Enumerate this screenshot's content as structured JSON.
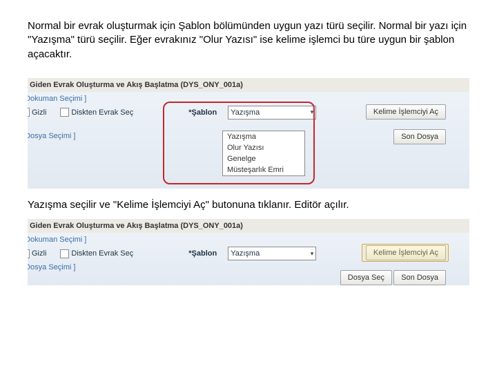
{
  "paragraphs": {
    "p1": "Normal bir evrak oluşturmak için Şablon bölümünden uygun yazı türü seçilir. Normal bir yazı için \"Yazışma\" türü seçilir. Eğer evrakınız \"Olur Yazısı\" ise kelime işlemci bu türe uygun bir şablon açacaktır.",
    "p2": "Yazışma seçilir ve \"Kelime İşlemciyi Aç\" butonuna tıklanır. Editör açılır."
  },
  "window": {
    "title": "Giden Evrak Oluşturma ve Akış Başlatma (DYS_ONY_001a)"
  },
  "sections": {
    "dokuman": "[ Dokuman Seçimi ]",
    "dosya": "[ Dosya Seçimi ]"
  },
  "checkboxes": {
    "gizli": "Gizli",
    "diskten": "Diskten Evrak Seç"
  },
  "sablon": {
    "label": "*Şablon",
    "selected": "Yazışma",
    "options": [
      "Yazışma",
      "Olur Yazısı",
      "Genelge",
      "Müsteşarlık Emri"
    ]
  },
  "buttons": {
    "editor": "Kelime İşlemciyi Aç",
    "dosya_sec": "Dosya Seç",
    "son_dosya": "Son Dosya"
  }
}
